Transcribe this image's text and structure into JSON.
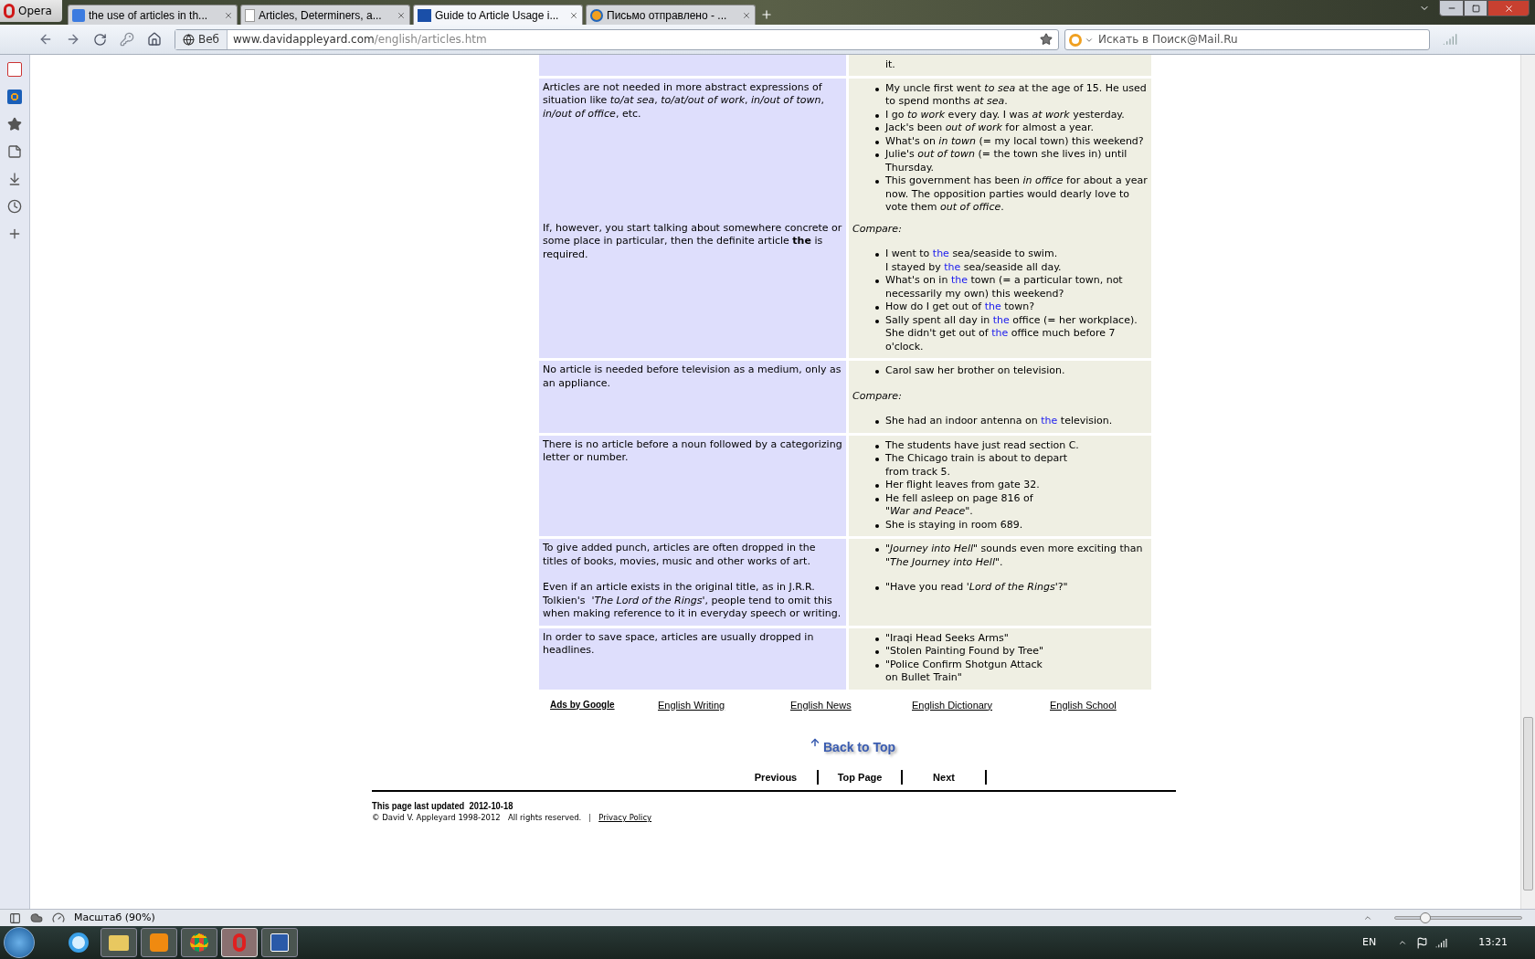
{
  "browser": {
    "opera_button": "Opera",
    "tabs": [
      {
        "title": "the use of articles in th...",
        "selected": false
      },
      {
        "title": "Articles, Determiners, a...",
        "selected": false
      },
      {
        "title": "Guide to Article Usage i...",
        "selected": true
      },
      {
        "title": "Письмо отправлено - ...",
        "selected": false
      }
    ],
    "address": {
      "badge": "Веб",
      "domain": "www.davidappleyard.com",
      "path": "/english/articles.htm"
    },
    "search": {
      "placeholder": "Искать в Поиск@Mail.Ru"
    }
  },
  "content": {
    "cut_row": {
      "example": "it."
    },
    "rows": [
      {
        "sections": [
          {
            "explanation": [
              "Articles are not needed in more abstract expressions of situation like *to/at sea*, *to/at/out of work*, *in/out of town*, *in/out of office*, etc."
            ],
            "examples": [
              {
                "kind": "list",
                "items": [
                  "My uncle first went *to sea* at the age of 15. He used to spend months *at sea*.",
                  "I go *to work* every day. I was *at work* yesterday.",
                  "Jack's been *out of work* for almost a year.",
                  "What's on *in town* (= my local town) this weekend?",
                  "Julie's *out of town* (= the town she lives in) until Thursday.",
                  "This government has been *in office* for about a year now. The opposition parties would dearly love to vote them *out of office*."
                ]
              }
            ]
          },
          {
            "explanation": [
              "If, however, you start talking about somewhere concrete or some place in particular, then the definite article **the** is required."
            ],
            "examples": [
              {
                "kind": "note",
                "text": "Compare:"
              },
              {
                "kind": "list",
                "items": [
                  {
                    "parts": [
                      "I went to ",
                      {
                        "text": "the",
                        "highlight": true
                      },
                      " sea/seaside to swim.\nI stayed by ",
                      {
                        "text": "the",
                        "highlight": true
                      },
                      " sea/seaside all day."
                    ]
                  },
                  {
                    "parts": [
                      "What's on in ",
                      {
                        "text": "the",
                        "highlight": true
                      },
                      " town (= a particular town, not necessarily my own) this weekend?"
                    ]
                  },
                  {
                    "parts": [
                      "How do I get out of ",
                      {
                        "text": "the",
                        "highlight": true
                      },
                      " town?"
                    ]
                  },
                  {
                    "parts": [
                      "Sally spent all day in ",
                      {
                        "text": "the",
                        "highlight": true
                      },
                      " office (= her workplace). She didn't get out of ",
                      {
                        "text": "the",
                        "highlight": true
                      },
                      " office much before 7 o'clock."
                    ]
                  }
                ]
              }
            ]
          }
        ]
      },
      {
        "sections": [
          {
            "explanation": [
              "No article is needed before television as a medium, only as an appliance."
            ],
            "examples": [
              {
                "kind": "list",
                "items": [
                  "Carol saw her brother on television."
                ]
              },
              {
                "kind": "note",
                "text": "Compare:"
              },
              {
                "kind": "list",
                "items": [
                  {
                    "parts": [
                      "She had an indoor antenna on ",
                      {
                        "text": "the",
                        "highlight": true
                      },
                      " television."
                    ]
                  }
                ]
              }
            ]
          }
        ]
      },
      {
        "sections": [
          {
            "explanation": [
              "There is no article before a noun followed by a categorizing letter or number."
            ],
            "examples": [
              {
                "kind": "list",
                "items": [
                  "The students have just read section C.",
                  "The Chicago train is about to depart\nfrom track 5.",
                  "Her flight leaves from gate 32.",
                  "He fell asleep on page 816 of\n\"*War and Peace*\".",
                  "She is staying in room 689."
                ]
              }
            ]
          }
        ]
      },
      {
        "sections": [
          {
            "explanation": [
              "To give added punch, articles are often dropped in the titles of books, movies, music and other works of art.",
              "Even if an article exists in the original title, as in J.R.R. Tolkien's  *'The Lord of the Rings'*, people tend to omit this when making reference to it in everyday speech or writing."
            ],
            "examples": [
              {
                "kind": "list",
                "items": [
                  "*\"Journey into Hell\"* sounds even more exciting than *\"The Journey into Hell\"*."
                ]
              },
              {
                "kind": "list",
                "items": [
                  "\"Have you read *'Lord of the Rings'*?\""
                ]
              }
            ]
          }
        ]
      },
      {
        "sections": [
          {
            "explanation": [
              "In order to save space, articles are usually dropped in headlines."
            ],
            "examples": [
              {
                "kind": "list",
                "items": [
                  "\"Iraqi Head Seeks Arms\"",
                  "\"Stolen Painting Found by Tree\"",
                  "\"Police Confirm Shotgun Attack\non Bullet Train\""
                ]
              }
            ]
          }
        ]
      }
    ]
  },
  "ads": {
    "label": "Ads by Google",
    "links": [
      "English Writing",
      "English News",
      "English Dictionary",
      "English School"
    ]
  },
  "back_to_top": "Back to Top",
  "nav": [
    "Previous",
    "Top Page",
    "Next"
  ],
  "footer": {
    "updated": "This page last updated  2012-10-18",
    "copyright": "© David V. Appleyard 1998-2012   All rights reserved.",
    "separator": "|",
    "privacy": "Privacy Policy"
  },
  "status_bar": {
    "zoom": "Масштаб (90%)",
    "zoom_slider": {
      "level": 0.24
    }
  },
  "taskbar": {
    "apps": [
      {
        "kind": "ie",
        "selected": false
      },
      {
        "kind": "explorer",
        "selected": false
      },
      {
        "kind": "media",
        "selected": false
      },
      {
        "kind": "chrome",
        "selected": false
      },
      {
        "kind": "opera",
        "selected": true
      },
      {
        "kind": "word",
        "selected": false
      }
    ],
    "language": "EN",
    "clock": "13:21"
  }
}
